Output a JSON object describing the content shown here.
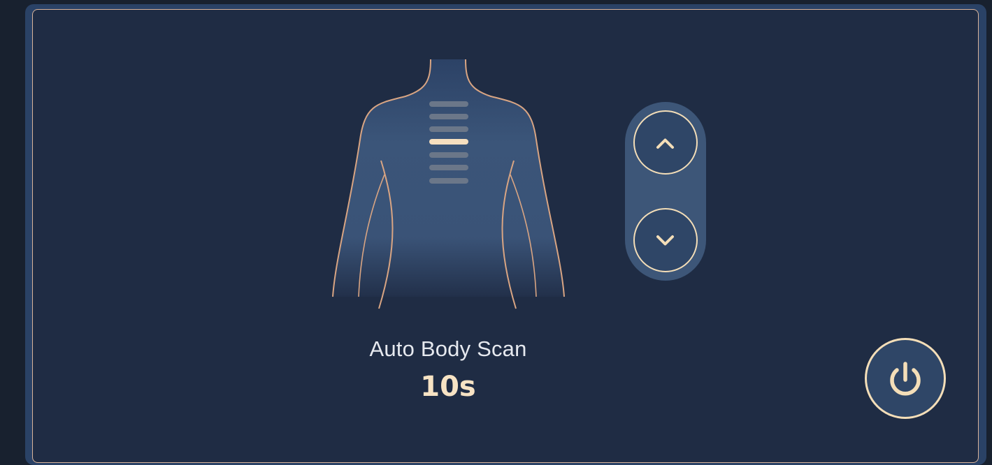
{
  "massage": {
    "mode_label": "Auto Body Scan",
    "timer": "10s",
    "active_segment": 4,
    "segment_count": 7
  },
  "controls": {
    "up_icon": "chevron-up-icon",
    "down_icon": "chevron-down-icon",
    "power_icon": "power-icon"
  },
  "colors": {
    "panel_bg": "#1f2c44",
    "accent": "#f4deb8",
    "outline": "#d9b49a",
    "stepper_bg": "#3d5678"
  }
}
